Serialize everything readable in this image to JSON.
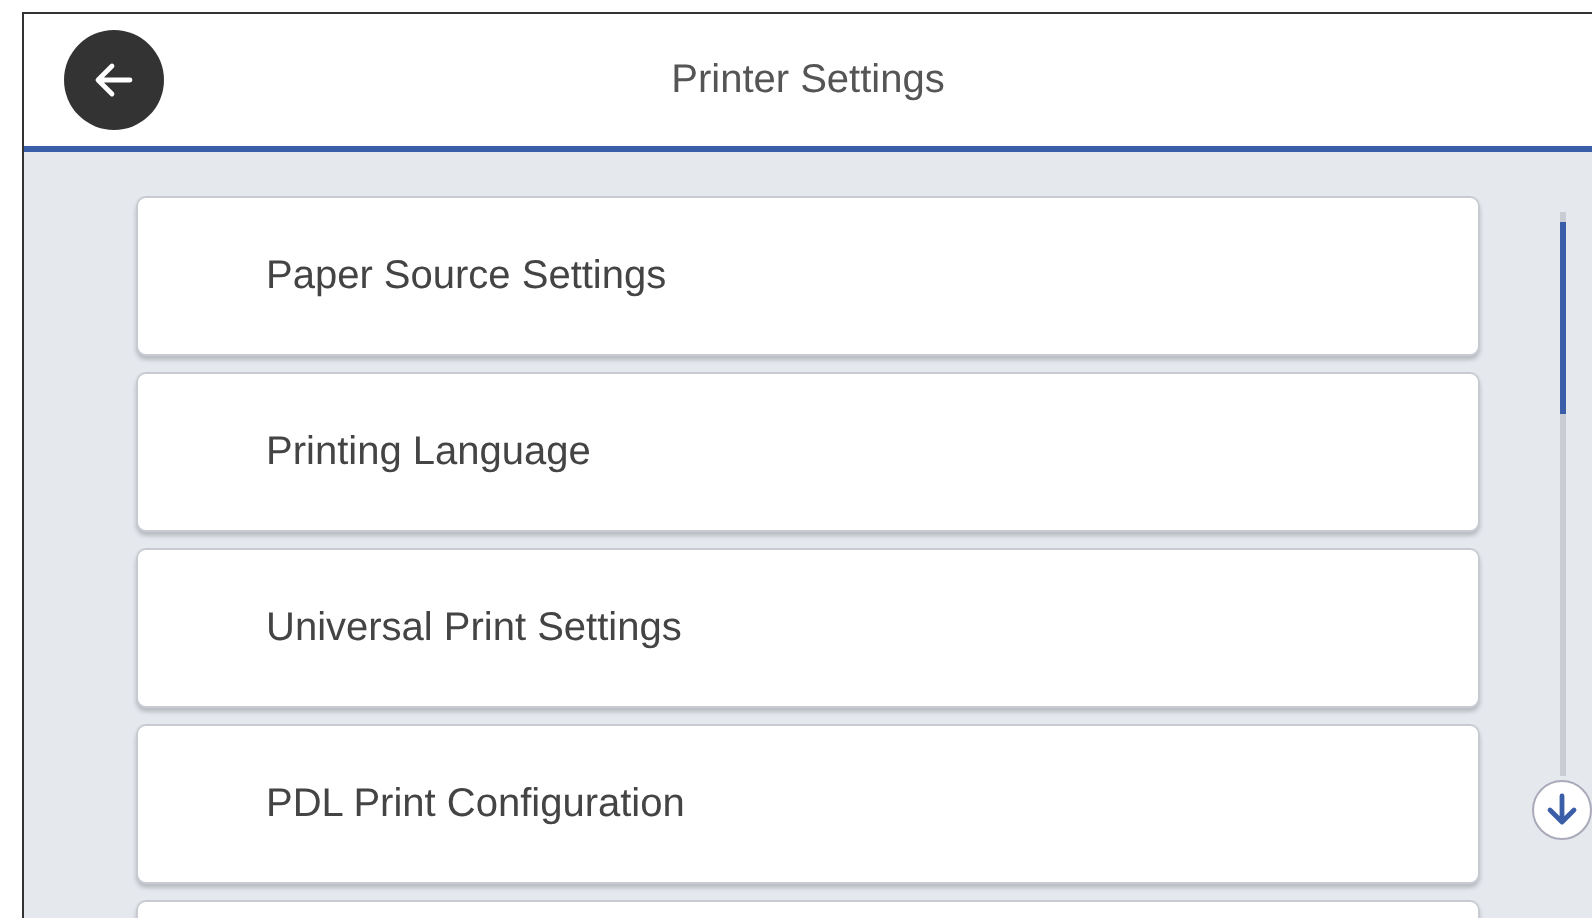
{
  "header": {
    "title": "Printer Settings"
  },
  "menu_items": [
    {
      "label": "Paper Source Settings"
    },
    {
      "label": "Printing Language"
    },
    {
      "label": "Universal Print Settings"
    },
    {
      "label": "PDL Print Configuration"
    }
  ]
}
